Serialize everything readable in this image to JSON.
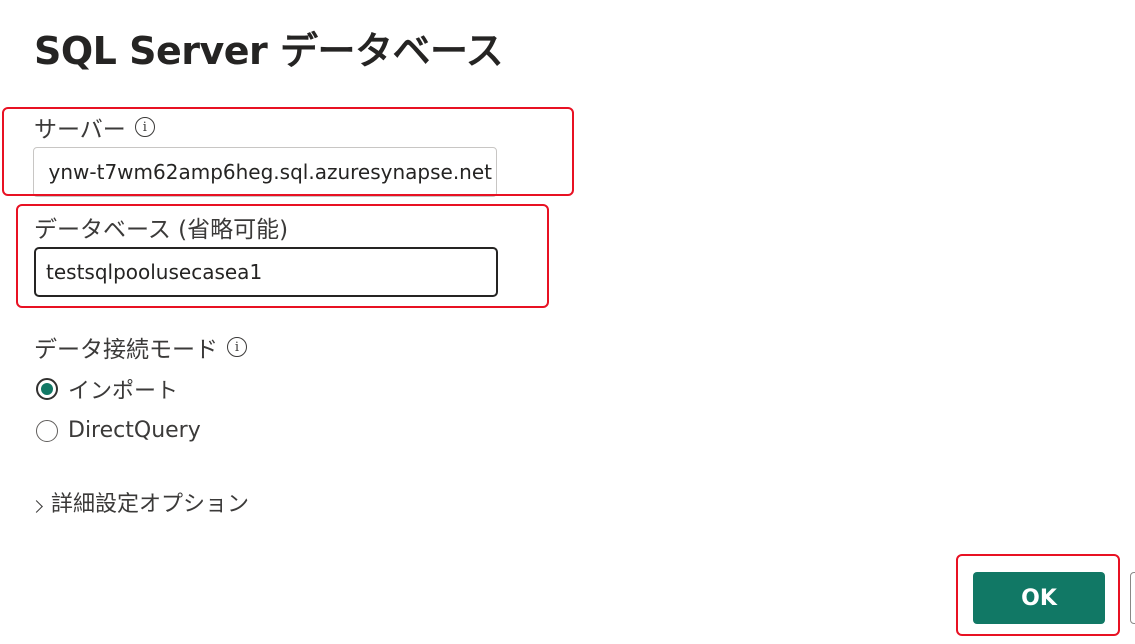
{
  "dialog": {
    "title": "SQL Server データベース"
  },
  "server": {
    "label": "サーバー",
    "value": "ynw-t7wm62amp6heg.sql.azuresynapse.net"
  },
  "database": {
    "label": "データベース (省略可能)",
    "value": "testsqlpoolusecasea1"
  },
  "connection_mode": {
    "label": "データ接続モード",
    "options": [
      {
        "label": "インポート",
        "selected": true
      },
      {
        "label": "DirectQuery",
        "selected": false
      }
    ]
  },
  "advanced": {
    "label": "詳細設定オプション"
  },
  "footer": {
    "ok_label": "OK"
  },
  "colors": {
    "accent": "#117865",
    "highlight": "#e81123"
  },
  "icons": {
    "info": "info-icon",
    "chevron": "chevron-right-icon"
  }
}
